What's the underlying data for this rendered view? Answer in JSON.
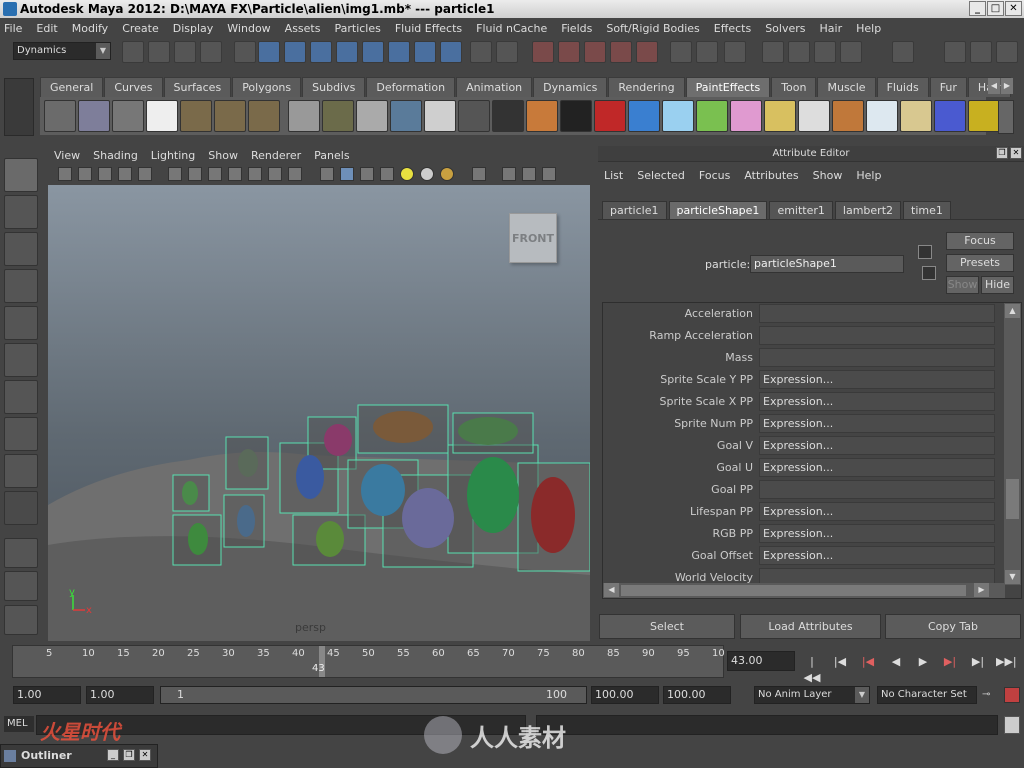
{
  "window": {
    "title": "Autodesk Maya 2012: D:\\MAYA FX\\Particle\\alien\\img1.mb*  ---  particle1",
    "controls": [
      "_",
      "□",
      "✕"
    ]
  },
  "menubar": [
    "File",
    "Edit",
    "Modify",
    "Create",
    "Display",
    "Window",
    "Assets",
    "Particles",
    "Fluid Effects",
    "Fluid nCache",
    "Fields",
    "Soft/Rigid Bodies",
    "Effects",
    "Solvers",
    "Hair",
    "Help"
  ],
  "statusline": {
    "menuset": "Dynamics"
  },
  "shelf": {
    "tabs": [
      "General",
      "Curves",
      "Surfaces",
      "Polygons",
      "Subdivs",
      "Deformation",
      "Animation",
      "Dynamics",
      "Rendering",
      "PaintEffects",
      "Toon",
      "Muscle",
      "Fluids",
      "Fur",
      "Hair"
    ],
    "active_tab": "PaintEffects"
  },
  "viewport": {
    "menu": [
      "View",
      "Shading",
      "Lighting",
      "Show",
      "Renderer",
      "Panels"
    ],
    "viewcube_label": "FRONT",
    "camera_label": "persp",
    "axis_y": "y",
    "axis_x": "x"
  },
  "attribute_editor": {
    "title": "Attribute Editor",
    "menu": [
      "List",
      "Selected",
      "Focus",
      "Attributes",
      "Show",
      "Help"
    ],
    "tabs": [
      "particle1",
      "particleShape1",
      "emitter1",
      "lambert2",
      "time1"
    ],
    "active_tab": "particleShape1",
    "node_label": "particle:",
    "node_value": "particleShape1",
    "focus_button": "Focus",
    "presets_button": "Presets",
    "show_button": "Show",
    "hide_button": "Hide",
    "attributes": [
      {
        "label": "Acceleration",
        "value": ""
      },
      {
        "label": "Ramp Acceleration",
        "value": ""
      },
      {
        "label": "Mass",
        "value": ""
      },
      {
        "label": "Sprite Scale Y PP",
        "value": "Expression..."
      },
      {
        "label": "Sprite Scale X PP",
        "value": "Expression..."
      },
      {
        "label": "Sprite Num PP",
        "value": "Expression..."
      },
      {
        "label": "Goal V",
        "value": "Expression..."
      },
      {
        "label": "Goal U",
        "value": "Expression..."
      },
      {
        "label": "Goal PP",
        "value": ""
      },
      {
        "label": "Lifespan PP",
        "value": "Expression..."
      },
      {
        "label": "RGB PP",
        "value": "Expression..."
      },
      {
        "label": "Goal Offset",
        "value": "Expression..."
      },
      {
        "label": "World Velocity",
        "value": ""
      }
    ],
    "buttons": [
      "Select",
      "Load Attributes",
      "Copy Tab"
    ]
  },
  "timeline": {
    "ticks": [
      "5",
      "10",
      "15",
      "20",
      "25",
      "30",
      "35",
      "40",
      "45",
      "50",
      "55",
      "60",
      "65",
      "70",
      "75",
      "80",
      "85",
      "90",
      "95",
      "10"
    ],
    "current_frame_marker": "43",
    "current_time": "43.00"
  },
  "range": {
    "start_time": "1.00",
    "playback_start": "1.00",
    "slider_start": "1",
    "slider_end": "100",
    "playback_end": "100.00",
    "end_time": "100.00",
    "anim_layer": "No Anim Layer",
    "character_set": "No Character Set"
  },
  "command_line": {
    "mel_label": "MEL"
  },
  "outliner": {
    "title": "Outliner"
  },
  "watermark": {
    "left": "火星时代",
    "right": "人人素材"
  },
  "colors": {
    "accent_tab": "#6e6e6e",
    "particle_box": "#58e0b0"
  }
}
